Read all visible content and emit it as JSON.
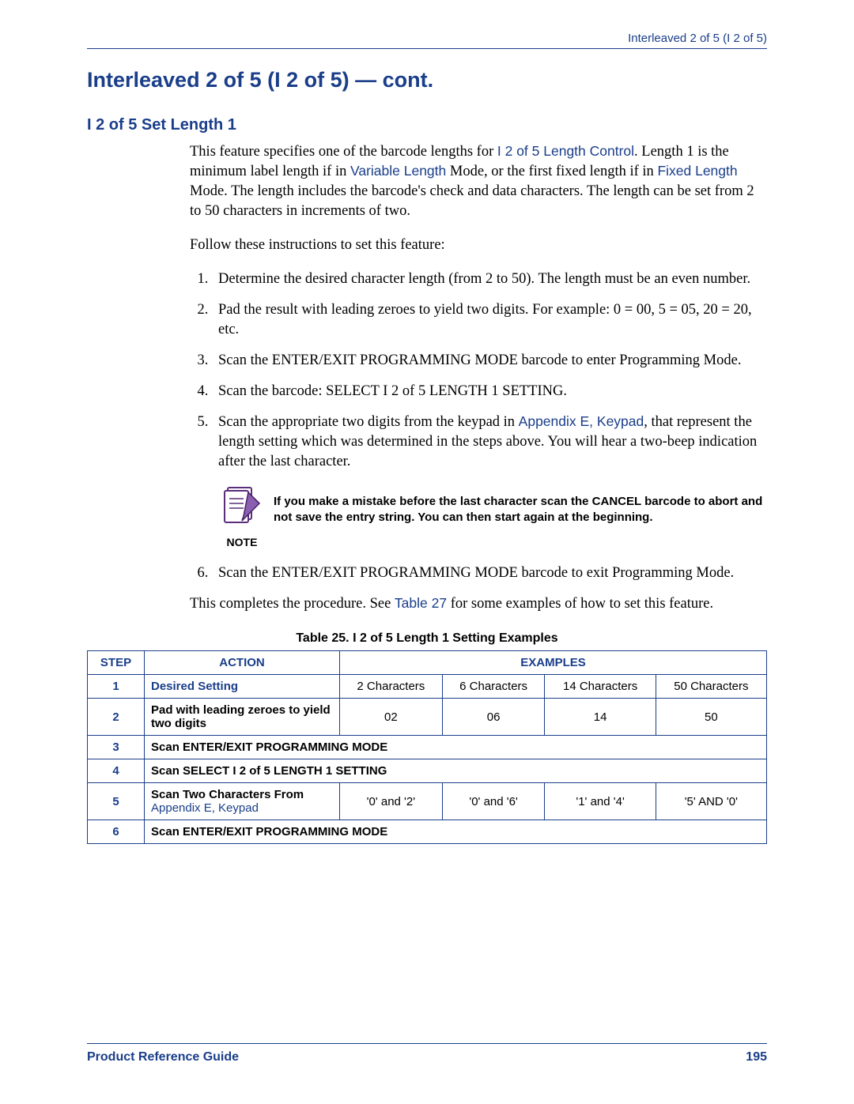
{
  "header": {
    "running_head": "Interleaved 2 of 5 (I 2 of 5)"
  },
  "title": "Interleaved 2 of 5 (I 2 of 5) — cont.",
  "section_heading": "I 2 of 5 Set Length 1",
  "intro": {
    "part1": "This feature specifies one of the barcode lengths for ",
    "link1": "I 2 of 5 Length Control",
    "part2": ". Length 1 is the minimum label length if in ",
    "link2": "Variable Length",
    "part3": " Mode, or the first fixed length if in ",
    "link3": "Fixed Length",
    "part4": " Mode. The length includes the barcode's check and data characters. The length can be set from 2 to 50 characters in increments of two."
  },
  "follow": "Follow these instructions to set this feature:",
  "steps": {
    "s1": "Determine the desired character length (from 2 to 50). The length must be an even number.",
    "s2": "Pad the result with leading zeroes to yield two digits. For example: 0 = 00, 5 = 05, 20 = 20, etc.",
    "s3": "Scan the ENTER/EXIT PROGRAMMING MODE barcode to enter Programming Mode.",
    "s4": "Scan the barcode: SELECT I 2 of 5 LENGTH 1 SETTING.",
    "s5_a": "Scan the appropriate two digits from the keypad in ",
    "s5_link": "Appendix E, Keypad",
    "s5_b": ", that represent the length setting which was determined in the steps above. You will hear a two-beep indication after the last character.",
    "s6": "Scan the ENTER/EXIT PROGRAMMING MODE barcode to exit Programming Mode."
  },
  "note": {
    "label": "NOTE",
    "text": "If you make a mistake before the last character scan the CANCEL barcode to abort and not save the entry string. You can then start again at the beginning."
  },
  "closing": {
    "a": "This completes the procedure. See ",
    "link": "Table 27",
    "b": " for some examples of how to set this feature."
  },
  "table": {
    "caption": "Table 25. I 2 of 5 Length 1 Setting Examples",
    "headers": {
      "step": "STEP",
      "action": "ACTION",
      "examples": "EXAMPLES"
    },
    "rows": {
      "r1": {
        "step": "1",
        "action": "Desired Setting",
        "c1": "2 Characters",
        "c2": "6 Characters",
        "c3": "14 Characters",
        "c4": "50 Characters"
      },
      "r2": {
        "step": "2",
        "action": "Pad with leading zeroes to yield two digits",
        "c1": "02",
        "c2": "06",
        "c3": "14",
        "c4": "50"
      },
      "r3": {
        "step": "3",
        "action": "Scan ENTER/EXIT PROGRAMMING MODE"
      },
      "r4": {
        "step": "4",
        "action": "Scan SELECT I 2 of 5 LENGTH 1 SETTING"
      },
      "r5": {
        "step": "5",
        "action_a": "Scan Two Characters From ",
        "action_link": "Appendix E, Keypad",
        "c1": "'0' and '2'",
        "c2": "'0' and '6'",
        "c3": "'1' and '4'",
        "c4": "'5' AND '0'"
      },
      "r6": {
        "step": "6",
        "action": "Scan ENTER/EXIT PROGRAMMING MODE"
      }
    }
  },
  "footer": {
    "left": "Product Reference Guide",
    "right": "195"
  }
}
